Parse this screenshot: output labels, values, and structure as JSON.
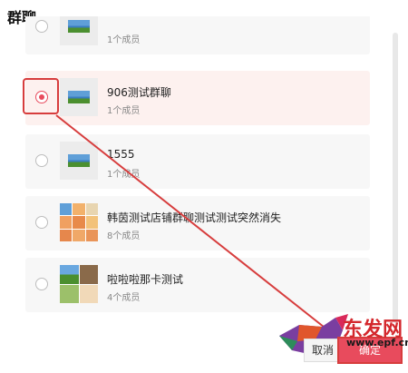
{
  "page": {
    "title": "群聊"
  },
  "groups": [
    {
      "name": "",
      "count": "1个成员",
      "selected": false
    },
    {
      "name": "906测试群聊",
      "count": "1个成员",
      "selected": true
    },
    {
      "name": "1555",
      "count": "1个成员",
      "selected": false
    },
    {
      "name": "韩茵测试店铺群聊测试测试突然消失",
      "count": "8个成员",
      "selected": false
    },
    {
      "name": "啦啦啦那卡测试",
      "count": "4个成员",
      "selected": false
    }
  ],
  "footer": {
    "cancel_label": "取消",
    "confirm_label": "确定"
  },
  "watermark": {
    "brand": "东发网",
    "url": "www.epf.cn"
  },
  "colors": {
    "accent": "#e84b5d",
    "annotation": "#d73d3d",
    "selected_bg": "#fdf1ef",
    "row_bg": "#f7f7f7"
  }
}
